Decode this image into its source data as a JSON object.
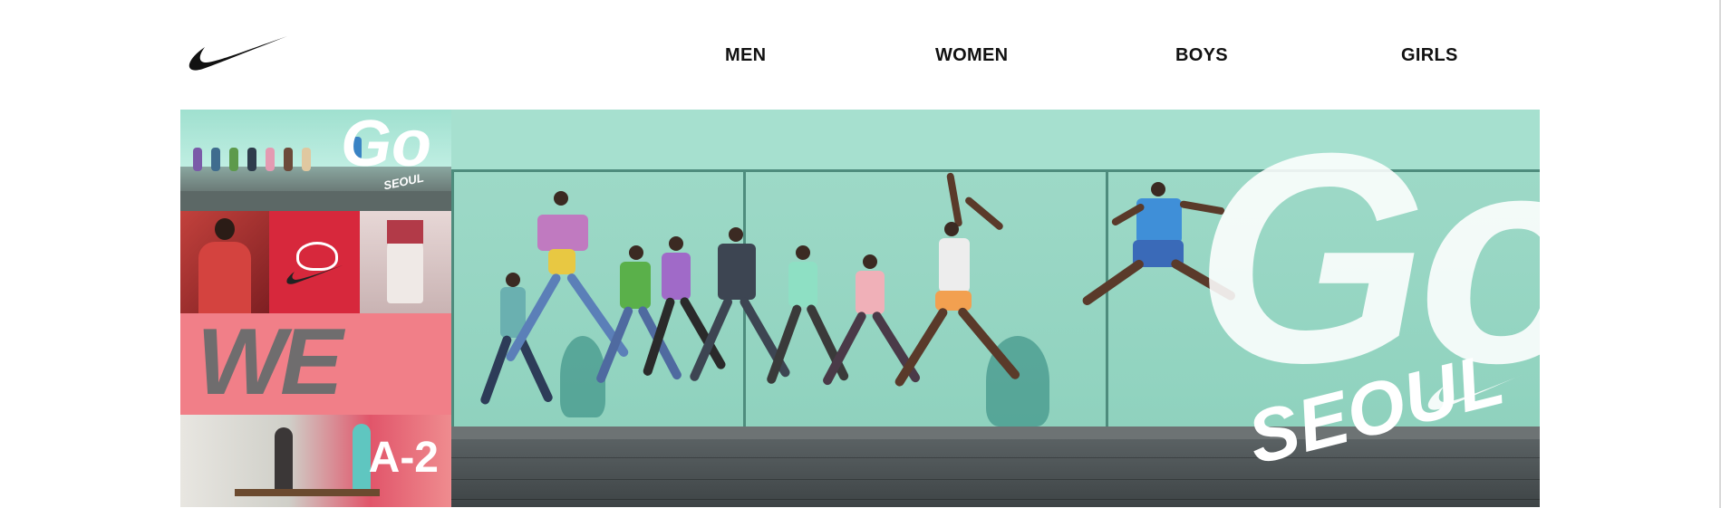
{
  "header": {
    "logo_icon": "nike-swoosh-icon",
    "nav": [
      {
        "label": "MEN"
      },
      {
        "label": "WOMEN"
      },
      {
        "label": "BOYS"
      },
      {
        "label": "GIRLS"
      }
    ]
  },
  "banner": {
    "mosaic": {
      "go_text": "Go",
      "seoul_text": "SEOUL",
      "wefly_text": "WE FLY.",
      "wall_text": "A-2"
    },
    "hero": {
      "go_text": "Go",
      "seoul_text": "SEOUL"
    }
  },
  "colors": {
    "mint": "#9bd9c6",
    "nav_text": "#111111",
    "red_tile": "#d7283c",
    "pink_tile": "#f17f88"
  }
}
